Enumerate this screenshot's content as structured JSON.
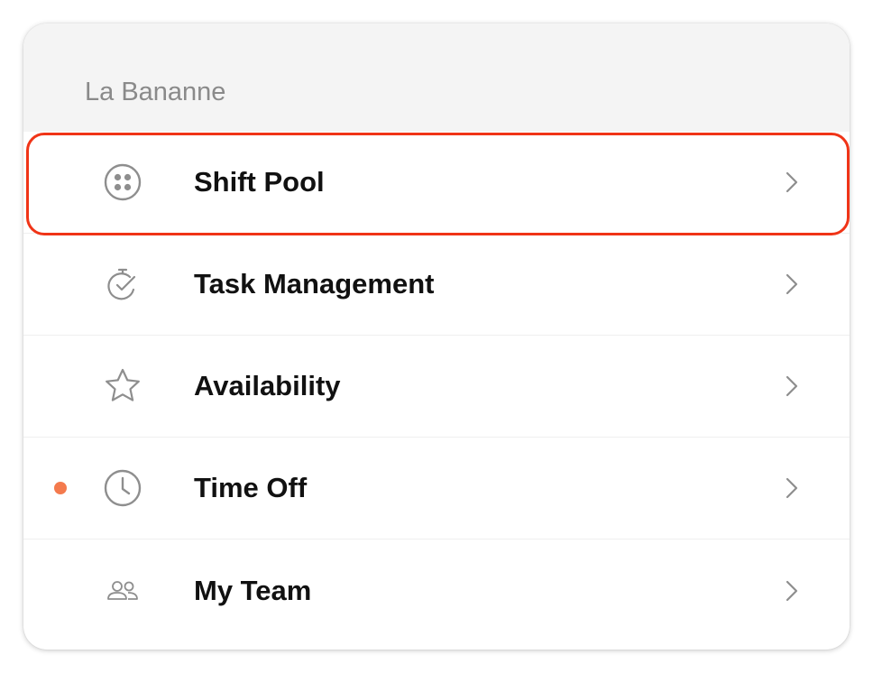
{
  "header": {
    "org_name": "La Bananne"
  },
  "menu": {
    "items": [
      {
        "label": "Shift Pool",
        "icon": "shift-pool-icon",
        "highlighted": true,
        "notification": false
      },
      {
        "label": "Task Management",
        "icon": "task-check-icon",
        "highlighted": false,
        "notification": false
      },
      {
        "label": "Availability",
        "icon": "star-icon",
        "highlighted": false,
        "notification": false
      },
      {
        "label": "Time Off",
        "icon": "clock-icon",
        "highlighted": false,
        "notification": true
      },
      {
        "label": "My Team",
        "icon": "team-icon",
        "highlighted": false,
        "notification": false
      }
    ]
  },
  "colors": {
    "highlight_border": "#f03417",
    "notification_dot": "#f47a4d",
    "icon_gray": "#8e8e8e",
    "header_bg": "#f4f4f4"
  }
}
